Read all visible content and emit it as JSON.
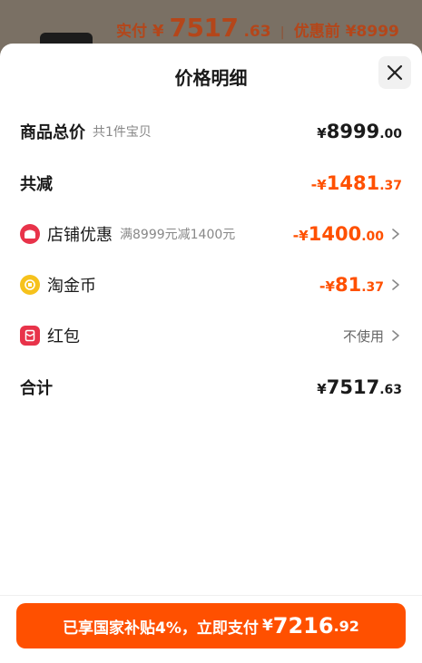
{
  "background": {
    "pay_label": "实付",
    "currency": "¥",
    "pay_int": "7517",
    "pay_dec": ".63",
    "separator": "|",
    "before_label": "优惠前",
    "before_price": "¥8999"
  },
  "sheet": {
    "title": "价格明细",
    "rows": [
      {
        "label": "商品总价",
        "sub": "共1件宝贝",
        "sign": "",
        "currency": "¥",
        "int": "8999",
        "dec": ".00"
      },
      {
        "label": "共减",
        "sign": "-",
        "currency": "¥",
        "int": "1481",
        "dec": ".37"
      },
      {
        "label": "店铺优惠",
        "sub": "满8999元减1400元",
        "icon": "shop-icon",
        "sign": "-",
        "currency": "¥",
        "int": "1400",
        "dec": ".00"
      },
      {
        "label": "淘金币",
        "icon": "gold-coin-icon",
        "sign": "-",
        "currency": "¥",
        "int": "81",
        "dec": ".37"
      },
      {
        "label": "红包",
        "icon": "red-packet-icon",
        "value_text": "不使用"
      },
      {
        "label": "合计",
        "currency": "¥",
        "int": "7517",
        "dec": ".63"
      }
    ]
  },
  "pay_button": {
    "text": "已享国家补贴4%，立即支付",
    "currency": "¥",
    "int": "7216",
    "dec": ".92"
  },
  "colors": {
    "accent": "#ff5000",
    "shop_icon": "#e8334a",
    "coin_icon": "#f6c21c",
    "red_packet_icon": "#e8334a"
  }
}
